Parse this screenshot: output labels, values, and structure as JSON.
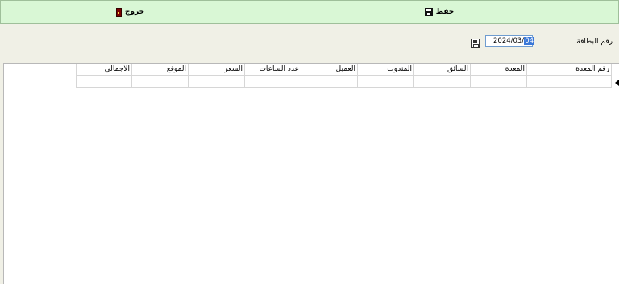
{
  "toolbar": {
    "exit_label": "خروج",
    "save_label": "حفظ"
  },
  "form": {
    "card_number_label": "رقم البطاقة",
    "date_value_before": "2024/03/",
    "date_value_selected": "04"
  },
  "grid": {
    "columns": [
      "الاجمالي",
      "الموقع",
      "السعر",
      "عدد الساعات",
      "العميل",
      "المندوب",
      "السائق",
      "المعدة",
      "رقم المعدة"
    ]
  },
  "colors": {
    "toolbar_bg": "#d9f7d5",
    "page_bg": "#f0f0e6"
  }
}
